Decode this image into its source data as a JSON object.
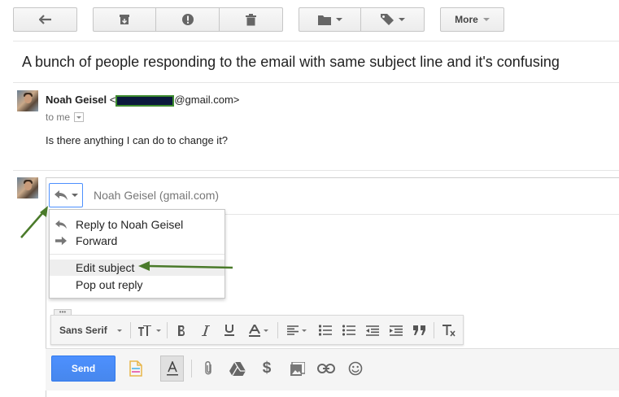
{
  "toolbar": {
    "more_label": "More"
  },
  "email": {
    "subject": "A bunch of people responding to the email with same subject line and it's confusing",
    "sender_name": "Noah Geisel",
    "sender_prefix": "<",
    "sender_domain": "@gmail.com>",
    "to_label": "to me",
    "body": "Is there anything I can do to change it?"
  },
  "reply": {
    "recipient": "Noah Geisel (gmail.com)",
    "menu_items": [
      {
        "label": "Reply to Noah Geisel",
        "icon": "reply-icon"
      },
      {
        "label": "Forward",
        "icon": "forward-icon"
      },
      {
        "label": "Edit subject",
        "highlighted": true
      },
      {
        "label": "Pop out reply"
      }
    ],
    "ellipsis": "•••"
  },
  "formatting": {
    "font_family": "Sans Serif",
    "icons": [
      "font-size-icon",
      "bold-icon",
      "italic-icon",
      "underline-icon",
      "text-color-icon",
      "align-icon",
      "numbered-list-icon",
      "bulleted-list-icon",
      "indent-less-icon",
      "indent-more-icon",
      "quote-icon",
      "remove-formatting-icon"
    ]
  },
  "compose": {
    "send_label": "Send",
    "icons": [
      "formatting-toggle-icon",
      "attach-icon",
      "drive-icon",
      "money-icon",
      "photo-icon",
      "link-icon",
      "emoji-icon"
    ]
  },
  "colors": {
    "send_blue": "#4d90fe",
    "annotation_arrow": "#4a7a2a",
    "redaction_fill": "#0b1a3d",
    "redaction_border": "#3c8a2e"
  }
}
